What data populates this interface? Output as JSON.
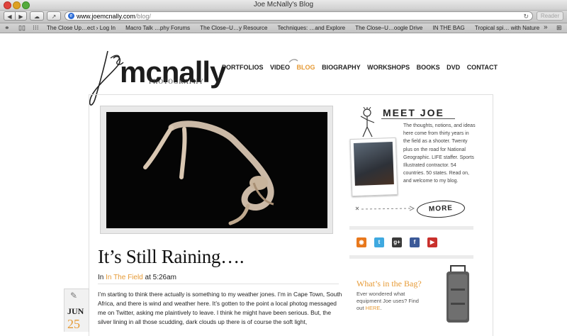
{
  "window": {
    "title": "Joe McNally's Blog"
  },
  "toolbar": {
    "url_host": "www.joemcnally.com",
    "url_path": "/blog/",
    "reader_label": "Reader"
  },
  "bookmarks": [
    "The Close Up…ect › Log In",
    "Macro Talk …phy Forums",
    "The Close–U…y Resource",
    "Techniques: …and Explore",
    "The Close–U…oogle Drive",
    "IN THE BAG",
    "Tropical spi… with Nature"
  ],
  "logo": {
    "text": "mcnally",
    "subtitle": "PHOTOGRAPHY"
  },
  "nav": [
    "PORTFOLIOS",
    "VIDEO",
    "BLOG",
    "BIOGRAPHY",
    "WORKSHOPS",
    "BOOKS",
    "DVD",
    "CONTACT"
  ],
  "nav_active": "BLOG",
  "post": {
    "title": "It’s Still Raining….",
    "meta_prefix": "In",
    "category": "In The Field",
    "meta_time": "at 5:26am",
    "body": "I’m starting to think there actually is something to my weather jones. I’m in Cape Town, South Africa, and there is wind and weather here. It’s gotten to the point a local photog messaged me on Twitter, asking me plaintively to leave. I think he might have been serious. But, the silver lining in all those scudding, dark clouds up there is of course the soft light,",
    "date_month": "JUN",
    "date_day": "25"
  },
  "sidebar": {
    "meet_title": "MEET JOE",
    "bio": "The thoughts, notions, and ideas here come from thirty years in the field as a shooter. Twenty plus on the road for National Geographic. LIFE staffer. Sports Illustrated contractor. 54 countries. 50 states. Read on, and welcome to my blog.",
    "more_label": "MORE",
    "social": [
      "rss-icon",
      "twitter-icon",
      "google-plus-icon",
      "facebook-icon",
      "youtube-icon"
    ],
    "bag_title": "What’s in the Bag?",
    "bag_text": "Ever wondered what equipment Joe uses? Find out",
    "bag_link": "HERE"
  },
  "colors": {
    "accent": "#e69a35"
  }
}
